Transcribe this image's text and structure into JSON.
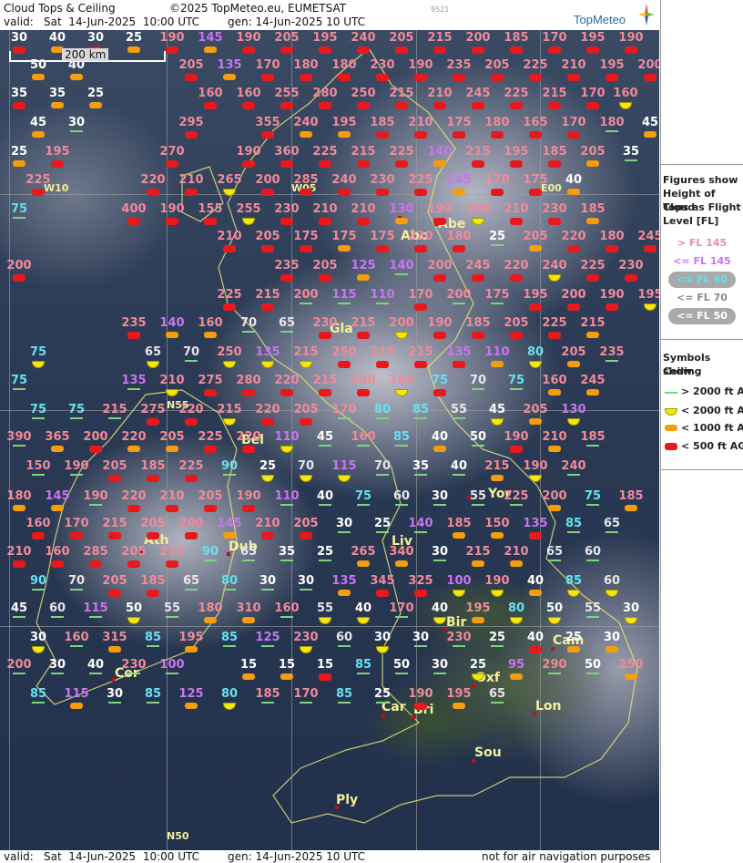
{
  "header": {
    "title": "Cloud Tops & Ceiling",
    "copyright": "©2025 TopMeteo.eu, EUMETSAT",
    "code": "9521",
    "valid_label": "valid:",
    "valid_value": "Sat  14-Jun-2025  10:00 UTC",
    "gen": "gen: 14-Jun-2025 10 UTC",
    "logo_text": "TopMeteo"
  },
  "footer": {
    "valid_label": "valid:",
    "valid_value": "Sat  14-Jun-2025  10:00 UTC",
    "gen": "gen: 14-Jun-2025 10 UTC",
    "disclaimer": "not for air navigation purposes"
  },
  "scale_label": "200 km",
  "grid_labels": [
    {
      "t": "W10"
    },
    {
      "t": "W05"
    },
    {
      "t": "E00"
    },
    {
      "t": "N55"
    },
    {
      "t": "N50"
    }
  ],
  "cities": [
    "Abo",
    "Abe",
    "Gla",
    "Bel",
    "Yor",
    "Ath",
    "Dub",
    "Liv",
    "Bir",
    "Cam",
    "Cor",
    "Oxf",
    "Car",
    "Bri",
    "Lon",
    "Sou",
    "Ply"
  ],
  "colors": {
    "gt145": "#f08a9a",
    "le145": "#c875f0",
    "le90": "#66e0f0",
    "le70": "#e6e6e6",
    "le50": "#ffffff",
    "sym_red": "#e8191d",
    "sym_orange": "#f59d0d",
    "sym_yellow": "#f5e60f",
    "sym_green": "#7ed47e"
  },
  "legend": {
    "tops_title": [
      "Figures show",
      "Height of Cloud",
      "Tops as Flight",
      "Level  [FL]"
    ],
    "tops_rows": [
      "> FL 145",
      "<= FL 145",
      "<= FL 90",
      "<= FL 70",
      "<= FL 50"
    ],
    "ceiling_title": [
      "Symbols show",
      "Ceiling"
    ],
    "ceiling_rows": [
      "> 2000 ft AGL",
      "< 2000 ft AGL",
      "< 1000 ft AGL",
      "< 500 ft AGL"
    ]
  },
  "stations": [
    {
      "v": "30",
      "s": "r"
    },
    {
      "v": "40",
      "s": "o"
    },
    {
      "v": "30",
      "s": "r"
    },
    {
      "v": "25",
      "s": "o"
    },
    {
      "v": "190",
      "s": "r"
    },
    {
      "v": "145",
      "s": "o"
    },
    {
      "v": "190",
      "s": "r"
    },
    {
      "v": "205",
      "s": "r"
    },
    {
      "v": "195",
      "s": "r"
    },
    {
      "v": "240",
      "s": "r"
    },
    {
      "v": "205",
      "s": "r"
    },
    {
      "v": "215",
      "s": "r"
    },
    {
      "v": "200",
      "s": "r"
    },
    {
      "v": "185",
      "s": "r"
    },
    {
      "v": "170",
      "s": "r"
    },
    {
      "v": "195",
      "s": "r"
    },
    {
      "v": "190",
      "s": "r"
    },
    {
      "v": "50",
      "s": "o"
    },
    {
      "v": "40",
      "s": "o"
    },
    {
      "v": "205",
      "s": "r"
    },
    {
      "v": "135",
      "s": "o"
    },
    {
      "v": "170",
      "s": "r"
    },
    {
      "v": "180",
      "s": "r"
    },
    {
      "v": "180",
      "s": "r"
    },
    {
      "v": "230",
      "s": "r"
    },
    {
      "v": "190",
      "s": "r"
    },
    {
      "v": "235",
      "s": "r"
    },
    {
      "v": "205",
      "s": "r"
    },
    {
      "v": "225",
      "s": "r"
    },
    {
      "v": "210",
      "s": "r"
    },
    {
      "v": "195",
      "s": "r"
    },
    {
      "v": "200",
      "s": "r"
    },
    {
      "v": "35",
      "s": "r"
    },
    {
      "v": "35",
      "s": "o"
    },
    {
      "v": "25",
      "s": "o"
    },
    {
      "v": "160",
      "s": "r"
    },
    {
      "v": "160",
      "s": "r"
    },
    {
      "v": "255",
      "s": "r"
    },
    {
      "v": "280",
      "s": "r"
    },
    {
      "v": "250",
      "s": "r"
    },
    {
      "v": "215",
      "s": "r"
    },
    {
      "v": "210",
      "s": "r"
    },
    {
      "v": "245",
      "s": "r"
    },
    {
      "v": "225",
      "s": "r"
    },
    {
      "v": "215",
      "s": "r"
    },
    {
      "v": "170",
      "s": "r"
    },
    {
      "v": "160",
      "s": "y"
    },
    {
      "v": "45",
      "s": "o"
    },
    {
      "v": "30",
      "s": "g"
    },
    {
      "v": "295",
      "s": "r"
    },
    {
      "v": "355",
      "s": "r"
    },
    {
      "v": "240",
      "s": "o"
    },
    {
      "v": "195",
      "s": "o"
    },
    {
      "v": "185",
      "s": "r"
    },
    {
      "v": "210",
      "s": "r"
    },
    {
      "v": "175",
      "s": "r"
    },
    {
      "v": "180",
      "s": "r"
    },
    {
      "v": "165",
      "s": "r"
    },
    {
      "v": "170",
      "s": "r"
    },
    {
      "v": "180",
      "s": "g"
    },
    {
      "v": "45",
      "s": "o"
    },
    {
      "v": "25",
      "s": "o"
    },
    {
      "v": "195",
      "s": "r"
    },
    {
      "v": "270",
      "s": "r"
    },
    {
      "v": "190",
      "s": "r"
    },
    {
      "v": "360",
      "s": "r"
    },
    {
      "v": "225",
      "s": "r"
    },
    {
      "v": "215",
      "s": "r"
    },
    {
      "v": "225",
      "s": "r"
    },
    {
      "v": "140",
      "s": "o"
    },
    {
      "v": "215",
      "s": "r"
    },
    {
      "v": "195",
      "s": "r"
    },
    {
      "v": "185",
      "s": "r"
    },
    {
      "v": "205",
      "s": "o"
    },
    {
      "v": "35",
      "s": "g"
    },
    {
      "v": "225",
      "s": "r"
    },
    {
      "v": "220",
      "s": "r"
    },
    {
      "v": "210",
      "s": "r"
    },
    {
      "v": "265",
      "s": "y"
    },
    {
      "v": "200",
      "s": "r"
    },
    {
      "v": "285",
      "s": "r"
    },
    {
      "v": "240",
      "s": "r"
    },
    {
      "v": "230",
      "s": "r"
    },
    {
      "v": "225",
      "s": "r"
    },
    {
      "v": "145",
      "s": "o"
    },
    {
      "v": "170",
      "s": "r"
    },
    {
      "v": "175",
      "s": "r"
    },
    {
      "v": "40",
      "s": "o"
    },
    {
      "v": "75",
      "s": "g"
    },
    {
      "v": "400",
      "s": "r"
    },
    {
      "v": "190",
      "s": "r"
    },
    {
      "v": "155",
      "s": "r"
    },
    {
      "v": "255",
      "s": "y"
    },
    {
      "v": "230",
      "s": "r"
    },
    {
      "v": "210",
      "s": "r"
    },
    {
      "v": "210",
      "s": "r"
    },
    {
      "v": "130",
      "s": "o"
    },
    {
      "v": "190",
      "s": "r"
    },
    {
      "v": "180",
      "s": "y"
    },
    {
      "v": "210",
      "s": "r"
    },
    {
      "v": "230",
      "s": "r"
    },
    {
      "v": "185",
      "s": "o"
    },
    {
      "v": "210",
      "s": "r"
    },
    {
      "v": "205",
      "s": "r"
    },
    {
      "v": "175",
      "s": "r"
    },
    {
      "v": "175",
      "s": "o"
    },
    {
      "v": "175",
      "s": "r"
    },
    {
      "v": "220",
      "s": "r"
    },
    {
      "v": "180",
      "s": "r"
    },
    {
      "v": "25",
      "s": "g"
    },
    {
      "v": "205",
      "s": "o"
    },
    {
      "v": "220",
      "s": "r"
    },
    {
      "v": "180",
      "s": "r"
    },
    {
      "v": "245",
      "s": "r"
    },
    {
      "v": "200",
      "s": "r"
    },
    {
      "v": "235",
      "s": "r"
    },
    {
      "v": "205",
      "s": "r"
    },
    {
      "v": "125",
      "s": "o"
    },
    {
      "v": "140",
      "s": "g"
    },
    {
      "v": "200",
      "s": "r"
    },
    {
      "v": "245",
      "s": "r"
    },
    {
      "v": "220",
      "s": "r"
    },
    {
      "v": "240",
      "s": "y"
    },
    {
      "v": "225",
      "s": "r"
    },
    {
      "v": "230",
      "s": "r"
    },
    {
      "v": "225",
      "s": "r"
    },
    {
      "v": "215",
      "s": "r"
    },
    {
      "v": "200",
      "s": "g"
    },
    {
      "v": "115",
      "s": "g"
    },
    {
      "v": "110",
      "s": "g"
    },
    {
      "v": "170",
      "s": "r"
    },
    {
      "v": "200",
      "s": "g"
    },
    {
      "v": "175",
      "s": "g"
    },
    {
      "v": "195",
      "s": "r"
    },
    {
      "v": "200",
      "s": "r"
    },
    {
      "v": "190",
      "s": "r"
    },
    {
      "v": "195",
      "s": "y"
    },
    {
      "v": "235",
      "s": "r"
    },
    {
      "v": "140",
      "s": "o"
    },
    {
      "v": "160",
      "s": "o"
    },
    {
      "v": "70",
      "s": "g"
    },
    {
      "v": "65",
      "s": "g"
    },
    {
      "v": "230",
      "s": "r"
    },
    {
      "v": "215",
      "s": "r"
    },
    {
      "v": "200",
      "s": "y"
    },
    {
      "v": "190",
      "s": "r"
    },
    {
      "v": "185",
      "s": "r"
    },
    {
      "v": "205",
      "s": "r"
    },
    {
      "v": "225",
      "s": "r"
    },
    {
      "v": "215",
      "s": "o"
    },
    {
      "v": "75",
      "s": "y"
    },
    {
      "v": "65",
      "s": "y"
    },
    {
      "v": "70",
      "s": "g"
    },
    {
      "v": "250",
      "s": "y"
    },
    {
      "v": "135",
      "s": "y"
    },
    {
      "v": "215",
      "s": "y"
    },
    {
      "v": "250",
      "s": "r"
    },
    {
      "v": "215",
      "s": "r"
    },
    {
      "v": "215",
      "s": "r"
    },
    {
      "v": "135",
      "s": "r"
    },
    {
      "v": "110",
      "s": "o"
    },
    {
      "v": "80",
      "s": "y"
    },
    {
      "v": "205",
      "s": "o"
    },
    {
      "v": "235",
      "s": "g"
    },
    {
      "v": "75",
      "s": "g"
    },
    {
      "v": "135",
      "s": "g"
    },
    {
      "v": "210",
      "s": "y"
    },
    {
      "v": "275",
      "s": "r"
    },
    {
      "v": "280",
      "s": "r"
    },
    {
      "v": "220",
      "s": "r"
    },
    {
      "v": "215",
      "s": "r"
    },
    {
      "v": "190",
      "s": "r"
    },
    {
      "v": "190",
      "s": "y"
    },
    {
      "v": "75",
      "s": "r"
    },
    {
      "v": "70",
      "s": "g"
    },
    {
      "v": "75",
      "s": "g"
    },
    {
      "v": "160",
      "s": "o"
    },
    {
      "v": "245",
      "s": "o"
    },
    {
      "v": "75",
      "s": "g"
    },
    {
      "v": "75",
      "s": "g"
    },
    {
      "v": "215",
      "s": "g"
    },
    {
      "v": "275",
      "s": "r"
    },
    {
      "v": "220",
      "s": "r"
    },
    {
      "v": "215",
      "s": "y"
    },
    {
      "v": "220",
      "s": "r"
    },
    {
      "v": "205",
      "s": "r"
    },
    {
      "v": "170",
      "s": "g"
    },
    {
      "v": "80",
      "s": "g"
    },
    {
      "v": "85",
      "s": "g"
    },
    {
      "v": "55",
      "s": "g"
    },
    {
      "v": "45",
      "s": "y"
    },
    {
      "v": "205",
      "s": "o"
    },
    {
      "v": "130",
      "s": "y"
    },
    {
      "v": "390",
      "s": "g"
    },
    {
      "v": "365",
      "s": "o"
    },
    {
      "v": "200",
      "s": "r"
    },
    {
      "v": "220",
      "s": "o"
    },
    {
      "v": "205",
      "s": "o"
    },
    {
      "v": "225",
      "s": "r"
    },
    {
      "v": "220",
      "s": "r"
    },
    {
      "v": "110",
      "s": "y"
    },
    {
      "v": "45",
      "s": "g"
    },
    {
      "v": "160",
      "s": "g"
    },
    {
      "v": "85",
      "s": "g"
    },
    {
      "v": "40",
      "s": "o"
    },
    {
      "v": "50",
      "s": "g"
    },
    {
      "v": "190",
      "s": "r"
    },
    {
      "v": "210",
      "s": "o"
    },
    {
      "v": "185",
      "s": "g"
    },
    {
      "v": "150",
      "s": "g"
    },
    {
      "v": "190",
      "s": "g"
    },
    {
      "v": "205",
      "s": "r"
    },
    {
      "v": "185",
      "s": "r"
    },
    {
      "v": "225",
      "s": "r"
    },
    {
      "v": "90",
      "s": "g"
    },
    {
      "v": "25",
      "s": "y"
    },
    {
      "v": "70",
      "s": "y"
    },
    {
      "v": "115",
      "s": "y"
    },
    {
      "v": "70",
      "s": "g"
    },
    {
      "v": "35",
      "s": "g"
    },
    {
      "v": "40",
      "s": "g"
    },
    {
      "v": "215",
      "s": "o"
    },
    {
      "v": "190",
      "s": "y"
    },
    {
      "v": "240",
      "s": "g"
    },
    {
      "v": "180",
      "s": "o"
    },
    {
      "v": "145",
      "s": "o"
    },
    {
      "v": "190",
      "s": "g"
    },
    {
      "v": "220",
      "s": "r"
    },
    {
      "v": "210",
      "s": "r"
    },
    {
      "v": "205",
      "s": "r"
    },
    {
      "v": "190",
      "s": "r"
    },
    {
      "v": "110",
      "s": "g"
    },
    {
      "v": "40",
      "s": "g"
    },
    {
      "v": "75",
      "s": "g"
    },
    {
      "v": "60",
      "s": "g"
    },
    {
      "v": "30",
      "s": "g"
    },
    {
      "v": "55",
      "s": "g"
    },
    {
      "v": "225",
      "s": "g"
    },
    {
      "v": "200",
      "s": "o"
    },
    {
      "v": "75",
      "s": "g"
    },
    {
      "v": "185",
      "s": "o"
    },
    {
      "v": "160",
      "s": "r"
    },
    {
      "v": "170",
      "s": "r"
    },
    {
      "v": "215",
      "s": "r"
    },
    {
      "v": "205",
      "s": "r"
    },
    {
      "v": "200",
      "s": "r"
    },
    {
      "v": "145",
      "s": "o"
    },
    {
      "v": "210",
      "s": "r"
    },
    {
      "v": "205",
      "s": "r"
    },
    {
      "v": "30",
      "s": "g"
    },
    {
      "v": "25",
      "s": "g"
    },
    {
      "v": "140",
      "s": "g"
    },
    {
      "v": "185",
      "s": "o"
    },
    {
      "v": "150",
      "s": "o"
    },
    {
      "v": "135",
      "s": "r"
    },
    {
      "v": "85",
      "s": "g"
    },
    {
      "v": "65",
      "s": "g"
    },
    {
      "v": "210",
      "s": "r"
    },
    {
      "v": "160",
      "s": "r"
    },
    {
      "v": "285",
      "s": "r"
    },
    {
      "v": "205",
      "s": "r"
    },
    {
      "v": "210",
      "s": "r"
    },
    {
      "v": "90",
      "s": "g"
    },
    {
      "v": "65",
      "s": "g"
    },
    {
      "v": "35",
      "s": "g"
    },
    {
      "v": "25",
      "s": "g"
    },
    {
      "v": "265",
      "s": "o"
    },
    {
      "v": "340",
      "s": "o"
    },
    {
      "v": "30",
      "s": "g"
    },
    {
      "v": "215",
      "s": "o"
    },
    {
      "v": "210",
      "s": "o"
    },
    {
      "v": "65",
      "s": "g"
    },
    {
      "v": "60",
      "s": "g"
    },
    {
      "v": "90",
      "s": "g"
    },
    {
      "v": "70",
      "s": "g"
    },
    {
      "v": "205",
      "s": "r"
    },
    {
      "v": "185",
      "s": "r"
    },
    {
      "v": "65",
      "s": "g"
    },
    {
      "v": "80",
      "s": "g"
    },
    {
      "v": "30",
      "s": "g"
    },
    {
      "v": "30",
      "s": "g"
    },
    {
      "v": "135",
      "s": "o"
    },
    {
      "v": "345",
      "s": "r"
    },
    {
      "v": "325",
      "s": "r"
    },
    {
      "v": "100",
      "s": "y"
    },
    {
      "v": "190",
      "s": "y"
    },
    {
      "v": "40",
      "s": "o"
    },
    {
      "v": "85",
      "s": "y"
    },
    {
      "v": "60",
      "s": "y"
    },
    {
      "v": "45",
      "s": "g"
    },
    {
      "v": "60",
      "s": "g"
    },
    {
      "v": "115",
      "s": "g"
    },
    {
      "v": "50",
      "s": "y"
    },
    {
      "v": "55",
      "s": "g"
    },
    {
      "v": "180",
      "s": "o"
    },
    {
      "v": "310",
      "s": "o"
    },
    {
      "v": "160",
      "s": "g"
    },
    {
      "v": "55",
      "s": "y"
    },
    {
      "v": "40",
      "s": "y"
    },
    {
      "v": "170",
      "s": "g"
    },
    {
      "v": "40",
      "s": "y"
    },
    {
      "v": "195",
      "s": "o"
    },
    {
      "v": "80",
      "s": "y"
    },
    {
      "v": "50",
      "s": "y"
    },
    {
      "v": "55",
      "s": "g"
    },
    {
      "v": "30",
      "s": "y"
    },
    {
      "v": "30",
      "s": "y"
    },
    {
      "v": "160",
      "s": "g"
    },
    {
      "v": "315",
      "s": "o"
    },
    {
      "v": "85",
      "s": "g"
    },
    {
      "v": "195",
      "s": "o"
    },
    {
      "v": "85",
      "s": "g"
    },
    {
      "v": "125",
      "s": "g"
    },
    {
      "v": "230",
      "s": "y"
    },
    {
      "v": "60",
      "s": "g"
    },
    {
      "v": "30",
      "s": "y"
    },
    {
      "v": "30",
      "s": "g"
    },
    {
      "v": "230",
      "s": "g"
    },
    {
      "v": "25",
      "s": "g"
    },
    {
      "v": "40",
      "s": "r"
    },
    {
      "v": "25",
      "s": "o"
    },
    {
      "v": "30",
      "s": "o"
    },
    {
      "v": "200",
      "s": "g"
    },
    {
      "v": "30",
      "s": "g"
    },
    {
      "v": "40",
      "s": "g"
    },
    {
      "v": "230",
      "s": "g"
    },
    {
      "v": "100",
      "s": "g"
    },
    {
      "v": "15",
      "s": "o"
    },
    {
      "v": "15",
      "s": "o"
    },
    {
      "v": "15",
      "s": "r"
    },
    {
      "v": "85",
      "s": "g"
    },
    {
      "v": "50",
      "s": "g"
    },
    {
      "v": "30",
      "s": "g"
    },
    {
      "v": "25",
      "s": "y"
    },
    {
      "v": "95",
      "s": "o"
    },
    {
      "v": "290",
      "s": "g"
    },
    {
      "v": "50",
      "s": "g"
    },
    {
      "v": "250",
      "s": "o"
    },
    {
      "v": "85",
      "s": "g"
    },
    {
      "v": "115",
      "s": "o"
    },
    {
      "v": "30",
      "s": "g"
    },
    {
      "v": "85",
      "s": "g"
    },
    {
      "v": "125",
      "s": "o"
    },
    {
      "v": "80",
      "s": "y"
    },
    {
      "v": "185",
      "s": "g"
    },
    {
      "v": "170",
      "s": "g"
    },
    {
      "v": "85",
      "s": "g"
    },
    {
      "v": "25",
      "s": "g"
    },
    {
      "v": "190",
      "s": "r"
    },
    {
      "v": "195",
      "s": "o"
    },
    {
      "v": "65",
      "s": "g"
    }
  ]
}
